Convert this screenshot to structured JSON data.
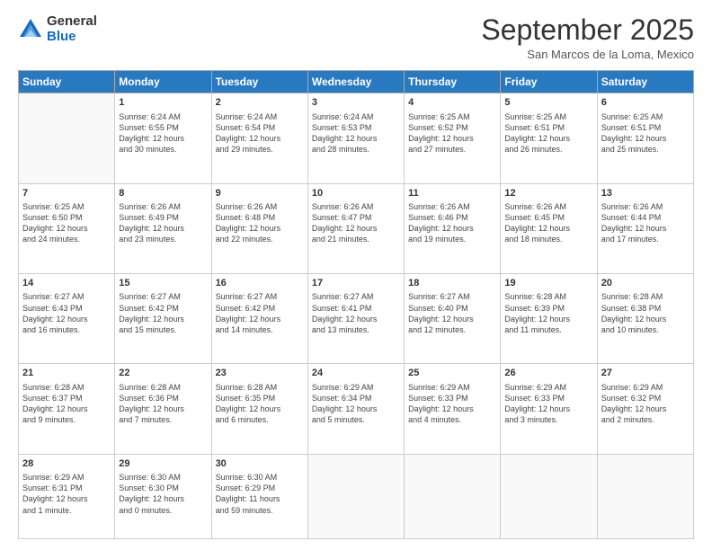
{
  "logo": {
    "general": "General",
    "blue": "Blue"
  },
  "title": "September 2025",
  "location": "San Marcos de la Loma, Mexico",
  "days_header": [
    "Sunday",
    "Monday",
    "Tuesday",
    "Wednesday",
    "Thursday",
    "Friday",
    "Saturday"
  ],
  "weeks": [
    [
      {
        "num": "",
        "info": ""
      },
      {
        "num": "1",
        "info": "Sunrise: 6:24 AM\nSunset: 6:55 PM\nDaylight: 12 hours\nand 30 minutes."
      },
      {
        "num": "2",
        "info": "Sunrise: 6:24 AM\nSunset: 6:54 PM\nDaylight: 12 hours\nand 29 minutes."
      },
      {
        "num": "3",
        "info": "Sunrise: 6:24 AM\nSunset: 6:53 PM\nDaylight: 12 hours\nand 28 minutes."
      },
      {
        "num": "4",
        "info": "Sunrise: 6:25 AM\nSunset: 6:52 PM\nDaylight: 12 hours\nand 27 minutes."
      },
      {
        "num": "5",
        "info": "Sunrise: 6:25 AM\nSunset: 6:51 PM\nDaylight: 12 hours\nand 26 minutes."
      },
      {
        "num": "6",
        "info": "Sunrise: 6:25 AM\nSunset: 6:51 PM\nDaylight: 12 hours\nand 25 minutes."
      }
    ],
    [
      {
        "num": "7",
        "info": "Sunrise: 6:25 AM\nSunset: 6:50 PM\nDaylight: 12 hours\nand 24 minutes."
      },
      {
        "num": "8",
        "info": "Sunrise: 6:26 AM\nSunset: 6:49 PM\nDaylight: 12 hours\nand 23 minutes."
      },
      {
        "num": "9",
        "info": "Sunrise: 6:26 AM\nSunset: 6:48 PM\nDaylight: 12 hours\nand 22 minutes."
      },
      {
        "num": "10",
        "info": "Sunrise: 6:26 AM\nSunset: 6:47 PM\nDaylight: 12 hours\nand 21 minutes."
      },
      {
        "num": "11",
        "info": "Sunrise: 6:26 AM\nSunset: 6:46 PM\nDaylight: 12 hours\nand 19 minutes."
      },
      {
        "num": "12",
        "info": "Sunrise: 6:26 AM\nSunset: 6:45 PM\nDaylight: 12 hours\nand 18 minutes."
      },
      {
        "num": "13",
        "info": "Sunrise: 6:26 AM\nSunset: 6:44 PM\nDaylight: 12 hours\nand 17 minutes."
      }
    ],
    [
      {
        "num": "14",
        "info": "Sunrise: 6:27 AM\nSunset: 6:43 PM\nDaylight: 12 hours\nand 16 minutes."
      },
      {
        "num": "15",
        "info": "Sunrise: 6:27 AM\nSunset: 6:42 PM\nDaylight: 12 hours\nand 15 minutes."
      },
      {
        "num": "16",
        "info": "Sunrise: 6:27 AM\nSunset: 6:42 PM\nDaylight: 12 hours\nand 14 minutes."
      },
      {
        "num": "17",
        "info": "Sunrise: 6:27 AM\nSunset: 6:41 PM\nDaylight: 12 hours\nand 13 minutes."
      },
      {
        "num": "18",
        "info": "Sunrise: 6:27 AM\nSunset: 6:40 PM\nDaylight: 12 hours\nand 12 minutes."
      },
      {
        "num": "19",
        "info": "Sunrise: 6:28 AM\nSunset: 6:39 PM\nDaylight: 12 hours\nand 11 minutes."
      },
      {
        "num": "20",
        "info": "Sunrise: 6:28 AM\nSunset: 6:38 PM\nDaylight: 12 hours\nand 10 minutes."
      }
    ],
    [
      {
        "num": "21",
        "info": "Sunrise: 6:28 AM\nSunset: 6:37 PM\nDaylight: 12 hours\nand 9 minutes."
      },
      {
        "num": "22",
        "info": "Sunrise: 6:28 AM\nSunset: 6:36 PM\nDaylight: 12 hours\nand 7 minutes."
      },
      {
        "num": "23",
        "info": "Sunrise: 6:28 AM\nSunset: 6:35 PM\nDaylight: 12 hours\nand 6 minutes."
      },
      {
        "num": "24",
        "info": "Sunrise: 6:29 AM\nSunset: 6:34 PM\nDaylight: 12 hours\nand 5 minutes."
      },
      {
        "num": "25",
        "info": "Sunrise: 6:29 AM\nSunset: 6:33 PM\nDaylight: 12 hours\nand 4 minutes."
      },
      {
        "num": "26",
        "info": "Sunrise: 6:29 AM\nSunset: 6:33 PM\nDaylight: 12 hours\nand 3 minutes."
      },
      {
        "num": "27",
        "info": "Sunrise: 6:29 AM\nSunset: 6:32 PM\nDaylight: 12 hours\nand 2 minutes."
      }
    ],
    [
      {
        "num": "28",
        "info": "Sunrise: 6:29 AM\nSunset: 6:31 PM\nDaylight: 12 hours\nand 1 minute."
      },
      {
        "num": "29",
        "info": "Sunrise: 6:30 AM\nSunset: 6:30 PM\nDaylight: 12 hours\nand 0 minutes."
      },
      {
        "num": "30",
        "info": "Sunrise: 6:30 AM\nSunset: 6:29 PM\nDaylight: 11 hours\nand 59 minutes."
      },
      {
        "num": "",
        "info": ""
      },
      {
        "num": "",
        "info": ""
      },
      {
        "num": "",
        "info": ""
      },
      {
        "num": "",
        "info": ""
      }
    ]
  ]
}
